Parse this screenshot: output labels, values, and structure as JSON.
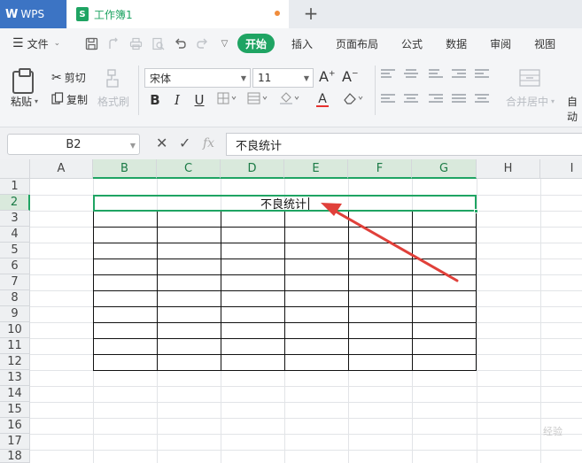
{
  "titlebar": {
    "app_tab": "WPS",
    "doc_tab": "工作簿1",
    "doc_icon": "S",
    "new_tab_symbol": "+"
  },
  "menubar": {
    "file_label": "文件",
    "items": [
      "开始",
      "插入",
      "页面布局",
      "公式",
      "数据",
      "审阅",
      "视图"
    ],
    "active_item": "开始",
    "accent_color": "#1fa463"
  },
  "ribbon": {
    "paste_label": "粘贴",
    "cut_label": "剪切",
    "copy_label": "复制",
    "format_painter_label": "格式刷",
    "font_name": "宋体",
    "font_size": "11",
    "bold": "B",
    "italic": "I",
    "underline": "U",
    "font_color_glyph": "A",
    "font_color": "#e8312f",
    "merge_center_label": "合并居中",
    "auto_wrap_label": "自动"
  },
  "formula_bar": {
    "cell_ref": "B2",
    "fx": "fx",
    "formula": "不良统计"
  },
  "grid": {
    "columns": [
      "A",
      "B",
      "C",
      "D",
      "E",
      "F",
      "G",
      "H",
      "I"
    ],
    "selected_columns": [
      "B",
      "C",
      "D",
      "E",
      "F",
      "G"
    ],
    "rows": [
      "1",
      "2",
      "3",
      "4",
      "5",
      "6",
      "7",
      "8",
      "9",
      "10",
      "11",
      "12",
      "13",
      "14",
      "15",
      "16",
      "17",
      "18"
    ],
    "selected_row": "2",
    "merged_cell_text": "不良统计"
  },
  "annotation": {
    "arrow_color": "#e0403a"
  },
  "watermark": {
    "text": "经验"
  }
}
